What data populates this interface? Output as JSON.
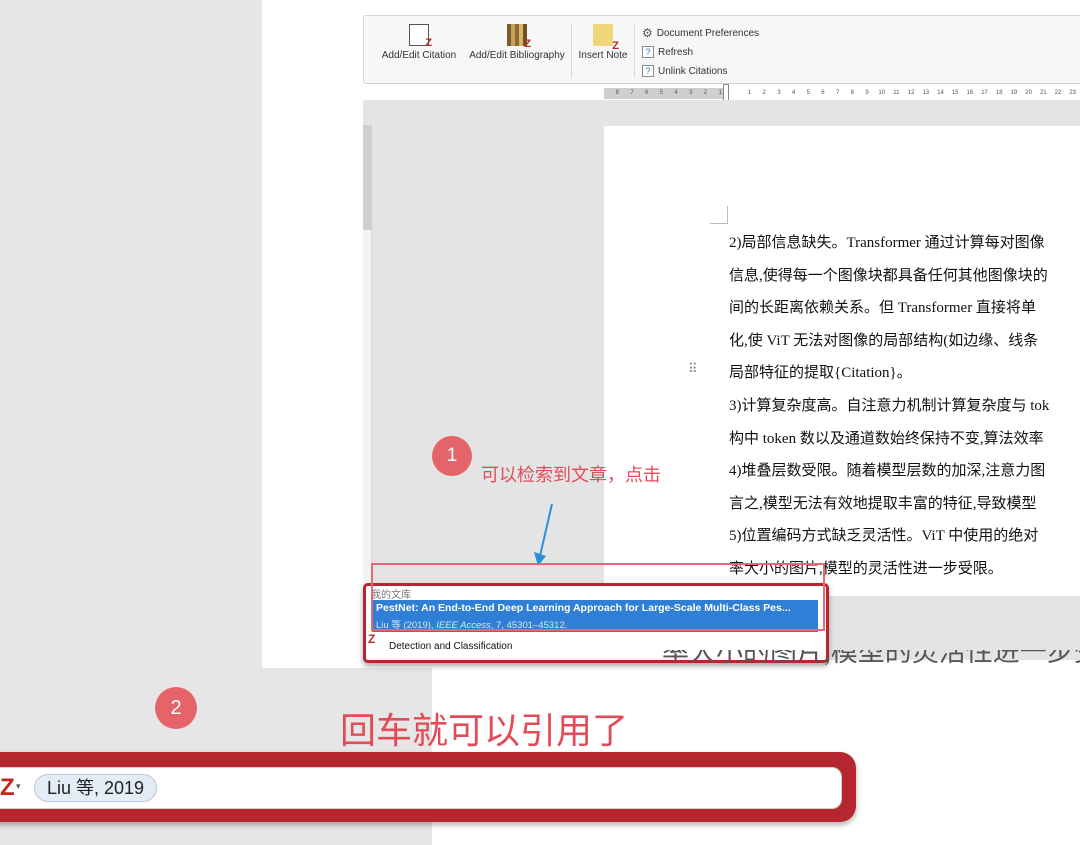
{
  "ribbon": {
    "add_edit_citation": "Add/Edit Citation",
    "add_edit_bibliography": "Add/Edit Bibliography",
    "insert_note": "Insert Note",
    "document_preferences": "Document Preferences",
    "refresh": "Refresh",
    "unlink_citations": "Unlink Citations",
    "question_glyph": "?"
  },
  "ruler": {
    "labels": [
      "8",
      "7",
      "6",
      "5",
      "4",
      "3",
      "2",
      "1",
      "",
      "1",
      "2",
      "3",
      "4",
      "5",
      "6",
      "7",
      "8",
      "9",
      "10",
      "11",
      "12",
      "13",
      "14",
      "15",
      "16",
      "17",
      "18",
      "19",
      "20",
      "21",
      "22",
      "23"
    ]
  },
  "document": {
    "lines": [
      "2)局部信息缺失。Transformer 通过计算每对图像",
      "信息,使得每一个图像块都具备任何其他图像块的",
      "间的长距离依赖关系。但 Transformer 直接将单",
      "化,使 ViT 无法对图像的局部结构(如边缘、线条",
      "局部特征的提取{Citation}。",
      "3)计算复杂度高。自注意力机制计算复杂度与 tok",
      "构中 token 数以及通道数始终保持不变,算法效率",
      "4)堆叠层数受限。随着模型层数的加深,注意力图",
      "言之,模型无法有效地提取丰富的特征,导致模型",
      "5)位置编码方式缺乏灵活性。ViT 中使用的绝对",
      "率大小的图片,模型的灵活性进一步受限。"
    ],
    "enlarged_line": "率大小的图片,模型的灵活性进一步受限。"
  },
  "callouts": {
    "badge1": "1",
    "note1": "可以检索到文章，点击",
    "badge2": "2",
    "note2": "回车就可以引用了"
  },
  "library_popup": {
    "header": "我的文库",
    "title": "PestNet: An End-to-End Deep Learning Approach for Large-Scale Multi-Class Pes...",
    "meta_prefix": "Liu 等 (2019), ",
    "meta_journal": "IEEE Access",
    "meta_suffix": ", 7, 45301–45312.",
    "continuation": "Detection and Classification",
    "z_glyph": "Z"
  },
  "citation_bar": {
    "z_glyph": "Z",
    "caret": "▾",
    "chip": "Liu 等, 2019"
  },
  "colors": {
    "accent_red": "#e24c58",
    "frame_red": "#b5262e",
    "selection_blue": "#2f7fd6"
  }
}
